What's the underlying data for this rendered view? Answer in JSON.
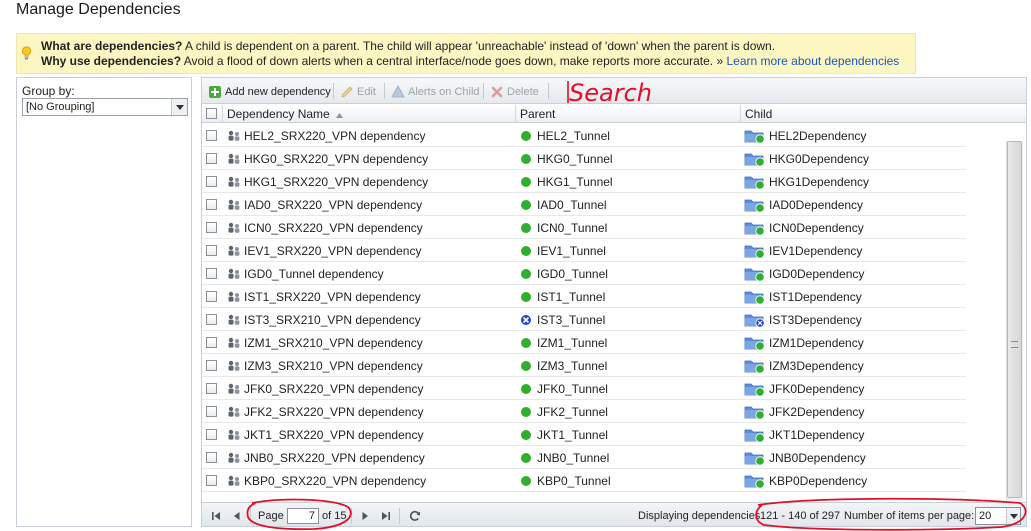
{
  "page": {
    "title": "Manage Dependencies"
  },
  "info": {
    "q1_bold": "What are dependencies?",
    "q1_text": " A child is dependent on a parent. The child will appear 'unreachable' instead of 'down' when the parent is down.",
    "q2_bold": "Why use dependencies?",
    "q2_text": " Avoid a flood of down alerts when a central interface/node goes down, make reports more accurate. » ",
    "learn_more": "Learn more about dependencies"
  },
  "grouping": {
    "label": "Group by:",
    "selected": "[No Grouping]"
  },
  "toolbar": {
    "add": "Add new dependency",
    "edit": "Edit",
    "alerts": "Alerts on Child",
    "delete": "Delete"
  },
  "annotation": {
    "search": "Search"
  },
  "columns": {
    "name": "Dependency Name",
    "parent": "Parent",
    "child": "Child"
  },
  "rows": [
    {
      "name": "HEL2_SRX220_VPN dependency",
      "parent": "HEL2_Tunnel",
      "child": "HEL2Dependency",
      "status": "up"
    },
    {
      "name": "HKG0_SRX220_VPN dependency",
      "parent": "HKG0_Tunnel",
      "child": "HKG0Dependency",
      "status": "up"
    },
    {
      "name": "HKG1_SRX220_VPN dependency",
      "parent": "HKG1_Tunnel",
      "child": "HKG1Dependency",
      "status": "up"
    },
    {
      "name": "IAD0_SRX220_VPN dependency",
      "parent": "IAD0_Tunnel",
      "child": "IAD0Dependency",
      "status": "up"
    },
    {
      "name": "ICN0_SRX220_VPN dependency",
      "parent": "ICN0_Tunnel",
      "child": "ICN0Dependency",
      "status": "up"
    },
    {
      "name": "IEV1_SRX220_VPN dependency",
      "parent": "IEV1_Tunnel",
      "child": "IEV1Dependency",
      "status": "up"
    },
    {
      "name": "IGD0_Tunnel dependency",
      "parent": "IGD0_Tunnel",
      "child": "IGD0Dependency",
      "status": "up"
    },
    {
      "name": "IST1_SRX220_VPN dependency",
      "parent": "IST1_Tunnel",
      "child": "IST1Dependency",
      "status": "up"
    },
    {
      "name": "IST3_SRX210_VPN dependency",
      "parent": "IST3_Tunnel",
      "child": "IST3Dependency",
      "status": "unknown"
    },
    {
      "name": "IZM1_SRX210_VPN dependency",
      "parent": "IZM1_Tunnel",
      "child": "IZM1Dependency",
      "status": "up"
    },
    {
      "name": "IZM3_SRX210_VPN dependency",
      "parent": "IZM3_Tunnel",
      "child": "IZM3Dependency",
      "status": "up"
    },
    {
      "name": "JFK0_SRX220_VPN dependency",
      "parent": "JFK0_Tunnel",
      "child": "JFK0Dependency",
      "status": "up"
    },
    {
      "name": "JFK2_SRX220_VPN dependency",
      "parent": "JFK2_Tunnel",
      "child": "JFK2Dependency",
      "status": "up"
    },
    {
      "name": "JKT1_SRX220_VPN dependency",
      "parent": "JKT1_Tunnel",
      "child": "JKT1Dependency",
      "status": "up"
    },
    {
      "name": "JNB0_SRX220_VPN dependency",
      "parent": "JNB0_Tunnel",
      "child": "JNB0Dependency",
      "status": "up"
    },
    {
      "name": "KBP0_SRX220_VPN dependency",
      "parent": "KBP0_Tunnel",
      "child": "KBP0Dependency",
      "status": "up"
    }
  ],
  "pager": {
    "page_label": "Page",
    "page_value": "7",
    "of_label": "of 15",
    "displaying": "Displaying dependencies",
    "range": "121 - 140 of 297",
    "per_page_label": "Number of items per page:",
    "per_page_value": "20"
  },
  "colors": {
    "up": "#2fae2f",
    "unknown": "#1f3fd8",
    "annotation": "#e0102a",
    "link": "#1b58b8",
    "info_bg": "#fbf6c2"
  }
}
